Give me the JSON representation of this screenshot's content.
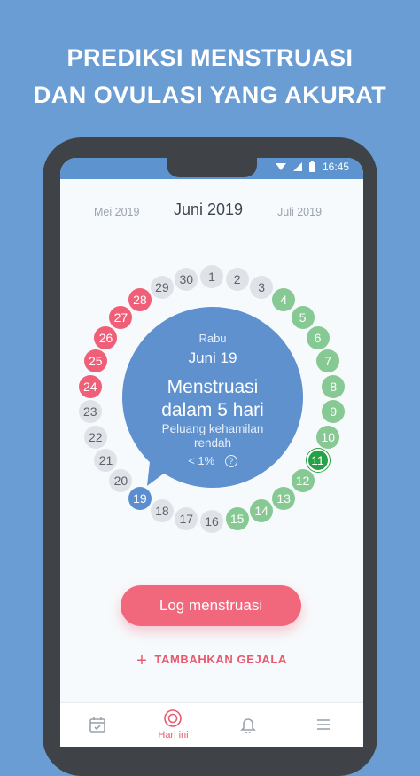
{
  "headline": {
    "line1": "PREDIKSI MENSTRUASI",
    "line2": "DAN OVULASI YANG AKURAT"
  },
  "status_bar": {
    "time": "16:45",
    "icons": [
      "wifi-icon",
      "signal-icon",
      "battery-icon"
    ]
  },
  "months": {
    "previous": "Mei 2019",
    "current": "Juni 2019",
    "next": "Juli 2019"
  },
  "cycle_days": [
    {
      "label": "1",
      "status": "gray"
    },
    {
      "label": "2",
      "status": "gray"
    },
    {
      "label": "3",
      "status": "gray"
    },
    {
      "label": "4",
      "status": "green"
    },
    {
      "label": "5",
      "status": "green"
    },
    {
      "label": "6",
      "status": "green"
    },
    {
      "label": "7",
      "status": "green"
    },
    {
      "label": "8",
      "status": "green"
    },
    {
      "label": "9",
      "status": "green"
    },
    {
      "label": "10",
      "status": "green"
    },
    {
      "label": "11",
      "status": "today"
    },
    {
      "label": "12",
      "status": "green"
    },
    {
      "label": "13",
      "status": "green"
    },
    {
      "label": "14",
      "status": "green"
    },
    {
      "label": "15",
      "status": "green"
    },
    {
      "label": "16",
      "status": "gray"
    },
    {
      "label": "17",
      "status": "gray"
    },
    {
      "label": "18",
      "status": "gray"
    },
    {
      "label": "19",
      "status": "blue"
    },
    {
      "label": "20",
      "status": "gray"
    },
    {
      "label": "21",
      "status": "gray"
    },
    {
      "label": "22",
      "status": "gray"
    },
    {
      "label": "23",
      "status": "gray"
    },
    {
      "label": "24",
      "status": "red"
    },
    {
      "label": "25",
      "status": "red"
    },
    {
      "label": "26",
      "status": "red"
    },
    {
      "label": "27",
      "status": "red"
    },
    {
      "label": "28",
      "status": "red"
    },
    {
      "label": "29",
      "status": "gray"
    },
    {
      "label": "30",
      "status": "gray"
    }
  ],
  "bubble": {
    "weekday": "Rabu",
    "date": "Juni 19",
    "title_line1": "Menstruasi",
    "title_line2": "dalam 5 hari",
    "subtitle_line1": "Peluang kehamilan",
    "subtitle_line2": "rendah",
    "probability": "< 1%",
    "help_icon": "?"
  },
  "actions": {
    "log_label": "Log menstruasi",
    "add_symptom_label": "TAMBAHKAN GEJALA",
    "add_symptom_icon": "+"
  },
  "nav": {
    "items": [
      {
        "icon": "calendar-icon",
        "label": ""
      },
      {
        "icon": "today-icon",
        "label": "Hari ini"
      },
      {
        "icon": "bell-icon",
        "label": ""
      },
      {
        "icon": "menu-icon",
        "label": ""
      }
    ],
    "active_color": "#e85a6f",
    "inactive_color": "#9aa3ad"
  },
  "colors": {
    "background": "#6a9dd3",
    "period": "#ef5f77",
    "fertile": "#86c993",
    "ovulation": "#26a246",
    "selected": "#5a8ed0",
    "neutral": "#dfe3e8",
    "bubble": "#5e91ce"
  }
}
